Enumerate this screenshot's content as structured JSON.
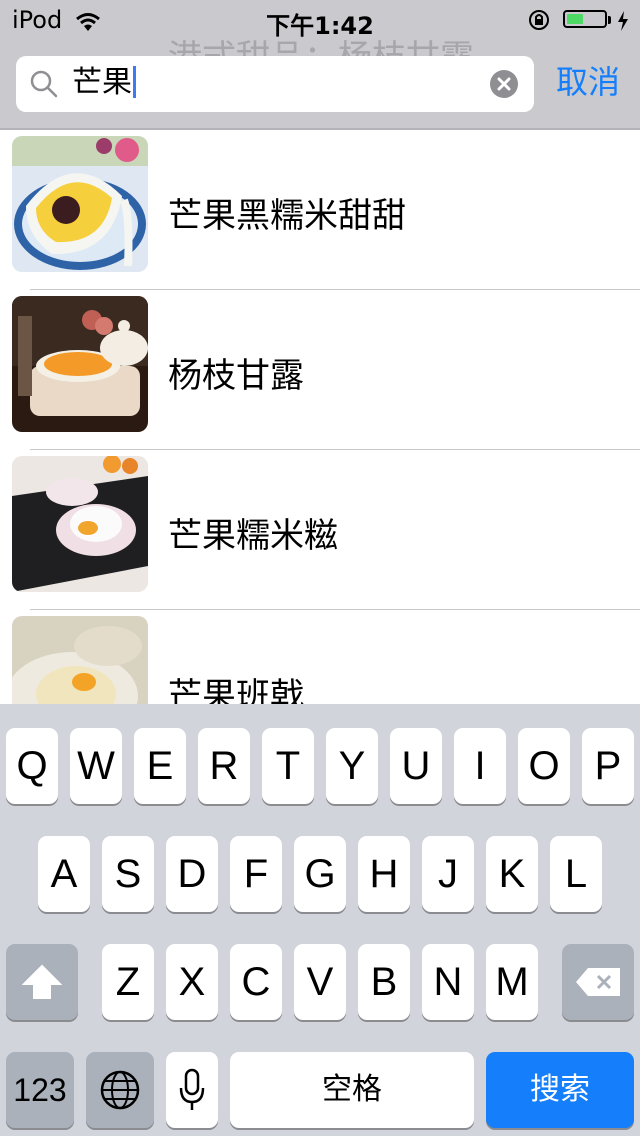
{
  "status_bar": {
    "carrier": "iPod",
    "time": "下午1:42",
    "battery_level": 0.45
  },
  "search": {
    "query": "芒果",
    "cancel_label": "取消"
  },
  "header": {
    "ghost_title": "港式甜品：杨枝甘露"
  },
  "results": [
    {
      "title": "芒果黑糯米甜甜"
    },
    {
      "title": "杨枝甘露"
    },
    {
      "title": "芒果糯米糍"
    },
    {
      "title": "芒果班戟"
    }
  ],
  "keyboard": {
    "row1": [
      "Q",
      "W",
      "E",
      "R",
      "T",
      "Y",
      "U",
      "I",
      "O",
      "P"
    ],
    "row2": [
      "A",
      "S",
      "D",
      "F",
      "G",
      "H",
      "J",
      "K",
      "L"
    ],
    "row3": [
      "Z",
      "X",
      "C",
      "V",
      "B",
      "N",
      "M"
    ],
    "numbers_label": "123",
    "space_label": "空格",
    "search_label": "搜索"
  },
  "colors": {
    "accent": "#147efb",
    "battery": "#4cd964",
    "keyboard_bg": "#d1d5db"
  }
}
